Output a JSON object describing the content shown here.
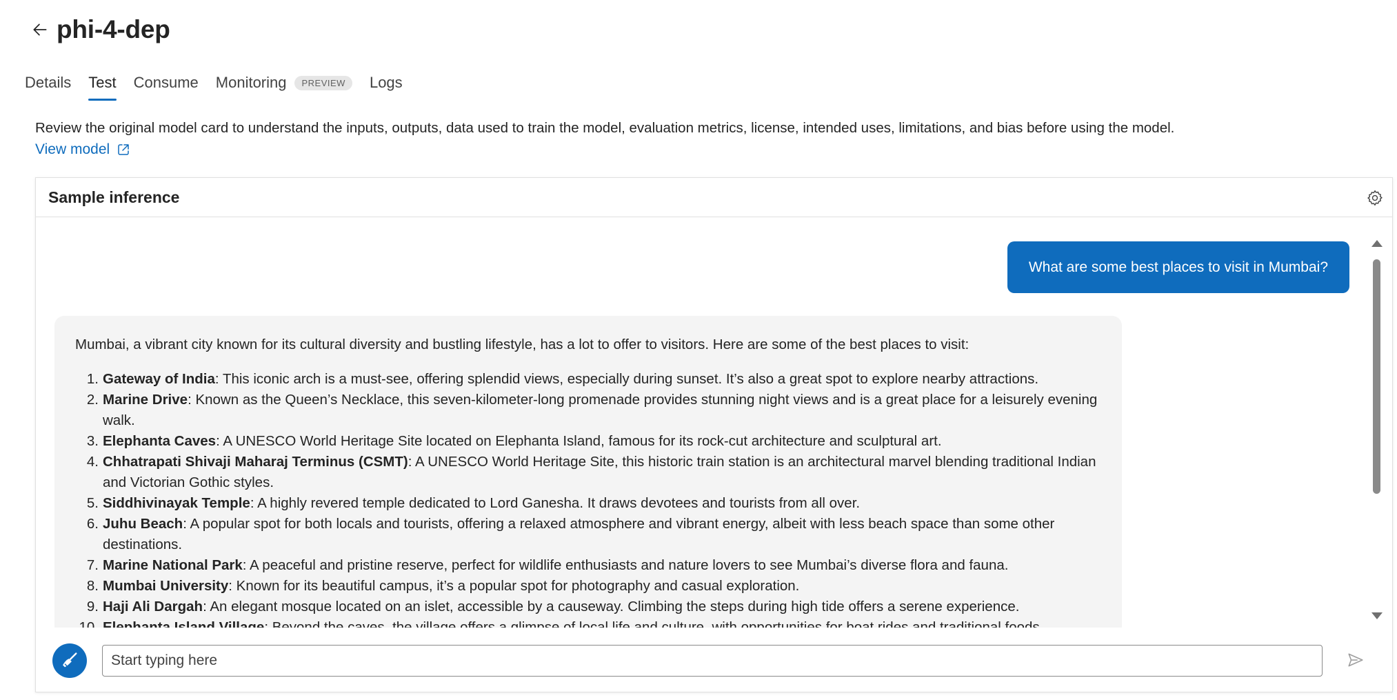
{
  "header": {
    "title": "phi-4-dep",
    "back_icon": "arrow-left-icon"
  },
  "tabs": [
    {
      "label": "Details",
      "active": false
    },
    {
      "label": "Test",
      "active": true
    },
    {
      "label": "Consume",
      "active": false
    },
    {
      "label": "Monitoring",
      "badge": "PREVIEW",
      "active": false
    },
    {
      "label": "Logs",
      "active": false
    }
  ],
  "disclaimer": "Review the original model card to understand the inputs, outputs, data used to train the model, evaluation metrics, license, intended uses, limitations, and bias before using the model.",
  "view_model": {
    "label": "View model",
    "icon": "external-link-icon"
  },
  "card": {
    "title": "Sample inference",
    "settings_icon": "gear-icon"
  },
  "chat": {
    "user_message": "What are some best places to visit in Mumbai?",
    "bot_intro": "Mumbai, a vibrant city known for its cultural diversity and bustling lifestyle, has a lot to offer to visitors. Here are some of the best places to visit:",
    "bot_items": [
      {
        "num": "1.",
        "title": "Gateway of India",
        "text": ": This iconic arch is a must-see, offering splendid views, especially during sunset. It’s also a great spot to explore nearby attractions."
      },
      {
        "num": "2.",
        "title": "Marine Drive",
        "text": ": Known as the Queen’s Necklace, this seven-kilometer-long promenade provides stunning night views and is a great place for a leisurely evening walk."
      },
      {
        "num": "3.",
        "title": "Elephanta Caves",
        "text": ": A UNESCO World Heritage Site located on Elephanta Island, famous for its rock-cut architecture and sculptural art."
      },
      {
        "num": "4.",
        "title": "Chhatrapati Shivaji Maharaj Terminus (CSMT)",
        "text": ": A UNESCO World Heritage Site, this historic train station is an architectural marvel blending traditional Indian and Victorian Gothic styles."
      },
      {
        "num": "5.",
        "title": "Siddhivinayak Temple",
        "text": ": A highly revered temple dedicated to Lord Ganesha. It draws devotees and tourists from all over."
      },
      {
        "num": "6.",
        "title": "Juhu Beach",
        "text": ": A popular spot for both locals and tourists, offering a relaxed atmosphere and vibrant energy, albeit with less beach space than some other destinations."
      },
      {
        "num": "7.",
        "title": "Marine National Park",
        "text": ": A peaceful and pristine reserve, perfect for wildlife enthusiasts and nature lovers to see Mumbai’s diverse flora and fauna."
      },
      {
        "num": "8.",
        "title": "Mumbai University",
        "text": ": Known for its beautiful campus, it’s a popular spot for photography and casual exploration."
      },
      {
        "num": "9.",
        "title": "Haji Ali Dargah",
        "text": ": An elegant mosque located on an islet, accessible by a causeway. Climbing the steps during high tide offers a serene experience."
      },
      {
        "num": "10.",
        "title": "Elephanta Island Village",
        "text": ": Beyond the caves, the village offers a glimpse of local life and culture, with opportunities for boat rides and traditional foods."
      }
    ]
  },
  "input": {
    "placeholder": "Start typing here",
    "value": ""
  },
  "icons": {
    "clear": "broom-icon",
    "send": "send-icon"
  },
  "colors": {
    "accent": "#0f6cbd"
  }
}
